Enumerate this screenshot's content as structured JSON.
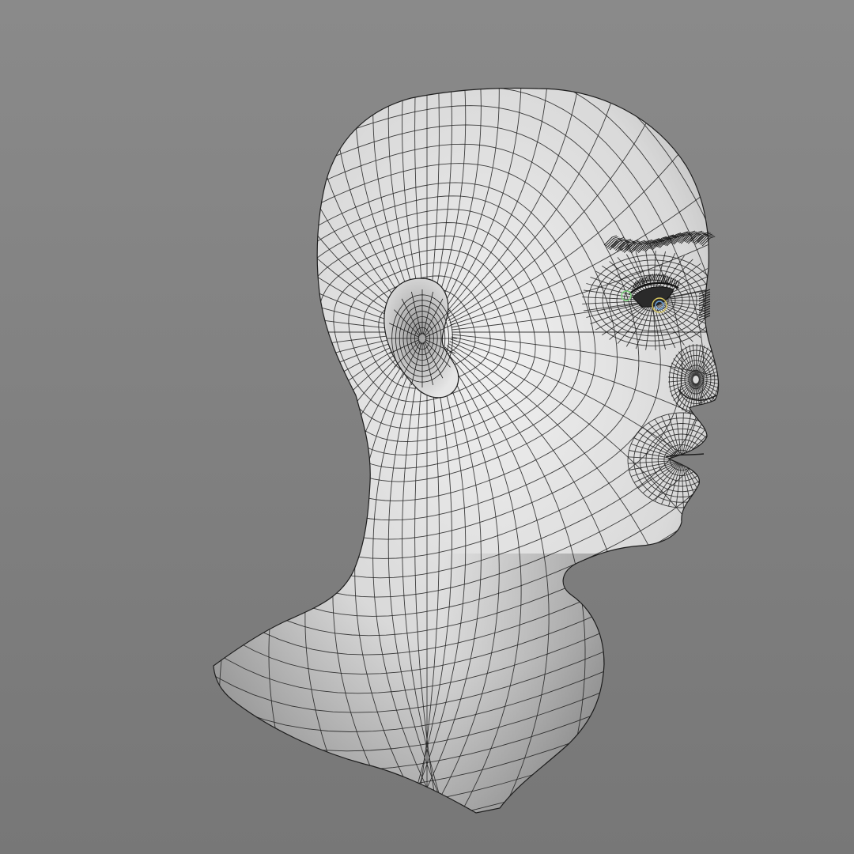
{
  "viewport": {
    "background_color": "#808080",
    "background_gradient": [
      "#8a8a8a",
      "#777777"
    ]
  },
  "model": {
    "subject": "head-and-neck-bust",
    "display_mode": "wireframe-on-shaded",
    "surface_color": "#d9d9d9",
    "highlight_color": "#f0f0f0",
    "shadow_color": "#8e8e8e",
    "wire_color": "#1e1e1e",
    "eyelash_color": "#1a1a1a",
    "eye_helper_colors": [
      "#7fd47f",
      "#d8c860",
      "#6aa0d8"
    ]
  }
}
